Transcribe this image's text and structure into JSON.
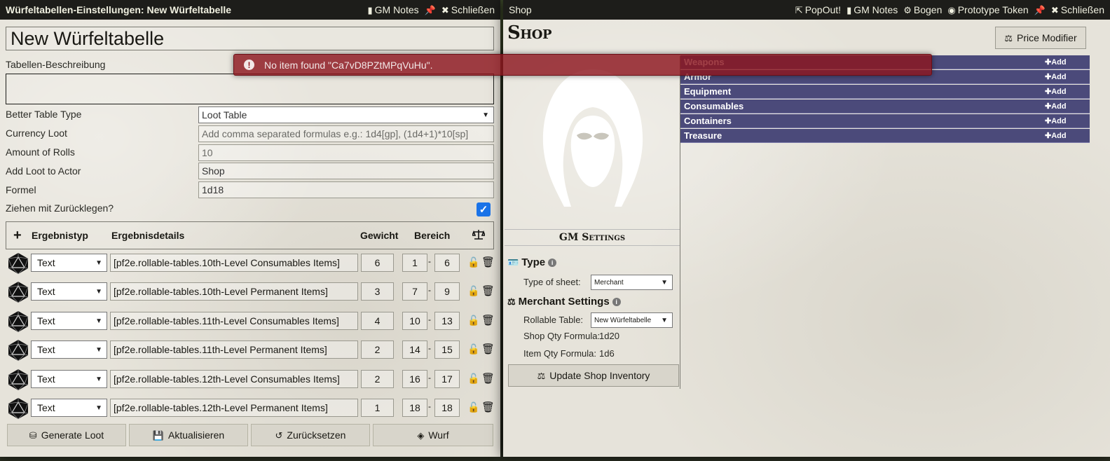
{
  "rolltable": {
    "window_title": "Würfeltabellen-Einstellungen: New Würfeltabelle",
    "gm_notes": "GM Notes",
    "close": "Schließen",
    "name": "New Würfeltabelle",
    "description_label": "Tabellen-Beschreibung",
    "fields": {
      "table_type_label": "Better Table Type",
      "table_type_value": "Loot Table",
      "currency_label": "Currency Loot",
      "currency_placeholder": "Add comma separated formulas e.g.: 1d4[gp], (1d4+1)*10[sp]",
      "rolls_label": "Amount of Rolls",
      "rolls_value": "10",
      "actor_label": "Add Loot to Actor",
      "actor_value": "Shop",
      "formula_label": "Formel",
      "formula_value": "1d18",
      "replacement_label": "Ziehen mit Zurücklegen?",
      "replacement_checked": true
    },
    "columns": {
      "type": "Ergebnistyp",
      "details": "Ergebnisdetails",
      "weight": "Gewicht",
      "range": "Bereich"
    },
    "results": [
      {
        "type": "Text",
        "details": "[pf2e.rollable-tables.10th-Level Consumables Items]",
        "weight": "6",
        "from": "1",
        "to": "6"
      },
      {
        "type": "Text",
        "details": "[pf2e.rollable-tables.10th-Level Permanent Items]",
        "weight": "3",
        "from": "7",
        "to": "9"
      },
      {
        "type": "Text",
        "details": "[pf2e.rollable-tables.11th-Level Consumables Items]",
        "weight": "4",
        "from": "10",
        "to": "13"
      },
      {
        "type": "Text",
        "details": "[pf2e.rollable-tables.11th-Level Permanent Items]",
        "weight": "2",
        "from": "14",
        "to": "15"
      },
      {
        "type": "Text",
        "details": "[pf2e.rollable-tables.12th-Level Consumables Items]",
        "weight": "2",
        "from": "16",
        "to": "17"
      },
      {
        "type": "Text",
        "details": "[pf2e.rollable-tables.12th-Level Permanent Items]",
        "weight": "1",
        "from": "18",
        "to": "18"
      }
    ],
    "buttons": {
      "generate": "Generate Loot",
      "update": "Aktualisieren",
      "reset": "Zurücksetzen",
      "roll": "Wurf"
    }
  },
  "shop": {
    "window_title": "Shop",
    "popout": "PopOut!",
    "gm_notes": "GM Notes",
    "sheet": "Bogen",
    "prototype_token": "Prototype Token",
    "close": "Schließen",
    "name": "Shop",
    "price_modifier": "Price Modifier",
    "gm_settings": "GM Settings",
    "type_heading": "Type",
    "type_of_sheet_label": "Type of sheet:",
    "type_of_sheet_value": "Merchant",
    "merchant_heading": "Merchant Settings",
    "rollable_table_label": "Rollable Table:",
    "rollable_table_value": "New Würfeltabelle",
    "shop_qty_label": "Shop Qty Formula:",
    "shop_qty_value": "1d20",
    "item_qty_label": "Item Qty Formula:",
    "item_qty_value": "1d6",
    "update_inventory": "Update Shop Inventory",
    "add_label": "Add",
    "categories": [
      "Weapons",
      "Armor",
      "Equipment",
      "Consumables",
      "Containers",
      "Treasure"
    ],
    "category_color": "#4b4a7a"
  },
  "notification": {
    "message": "No item found \"Ca7vD8PZtMPqVuHu\".",
    "color": "#8c161e"
  }
}
